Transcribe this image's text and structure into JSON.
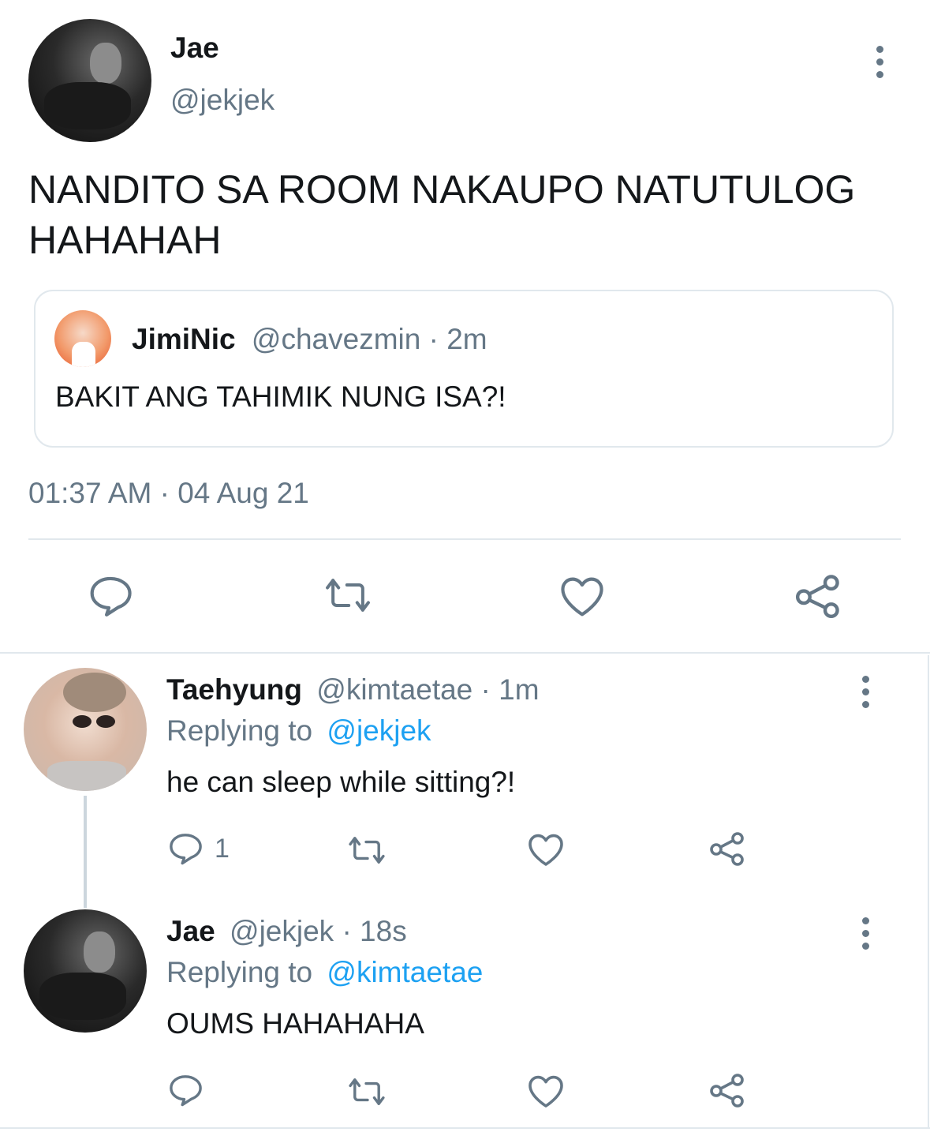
{
  "main_tweet": {
    "author_name": "Jae",
    "author_handle": "@jekjek",
    "text_line1": "NANDITO SA ROOM NAKAUPO NATUTULOG",
    "text_line2": "HAHAHAH",
    "timestamp": "01:37 AM · 04 Aug 21",
    "quoted": {
      "author_name": "JimiNic",
      "author_meta": "@chavezmin · 2m",
      "text": "BAKIT ANG TAHIMIK NUNG ISA?!"
    }
  },
  "replies": [
    {
      "author_name": "Taehyung",
      "author_meta": "@kimtaetae · 1m",
      "replying_prefix": "Replying to",
      "replying_to": "@jekjek",
      "text": "he can sleep while sitting?!",
      "reply_count": "1"
    },
    {
      "author_name": "Jae",
      "author_meta": "@jekjek · 18s",
      "replying_prefix": "Replying to",
      "replying_to": "@kimtaetae",
      "text": "OUMS HAHAHAHA",
      "reply_count": ""
    }
  ],
  "icons": {
    "reply": "reply-icon",
    "retweet": "retweet-icon",
    "like": "heart-icon",
    "share": "share-icon",
    "more": "more-options-icon"
  },
  "colors": {
    "text": "#14171a",
    "muted": "#657786",
    "link": "#1da1f2",
    "divider": "#e1e8ed"
  }
}
